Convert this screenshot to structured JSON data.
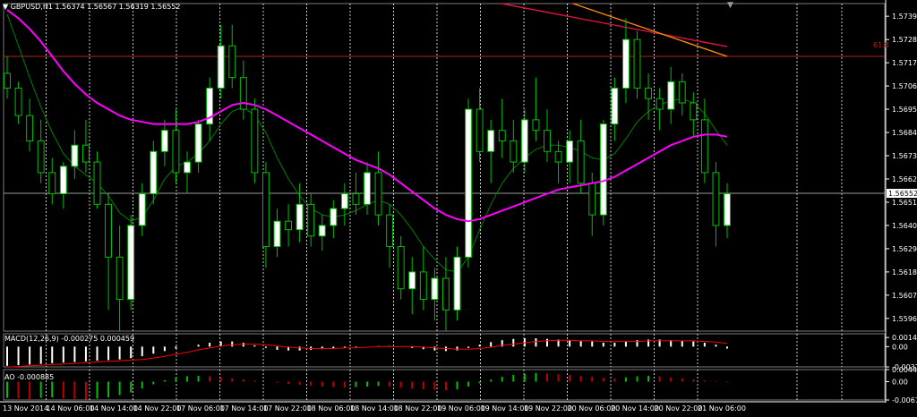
{
  "symbol_header": "GBPUSD,H1  1.56374 1.56567 1.56319 1.56552",
  "fib_label": "61.8",
  "current_price": "1.56552",
  "macd_label": "MACD(12,26,9) -0.000275 0.000459",
  "ao_label": "AO -0.000885",
  "price_ticks": [
    "1.57390",
    "1.57280",
    "1.57170",
    "1.57060",
    "1.56950",
    "1.56840",
    "1.56730",
    "1.56620",
    "1.56510",
    "1.56400",
    "1.56290",
    "1.56180",
    "1.56070",
    "1.55960"
  ],
  "macd_ticks": [
    "0.001422",
    "0.00",
    "-0.003165"
  ],
  "ao_ticks": [
    "0.004483",
    "0.00",
    "-0.006797"
  ],
  "time_labels": [
    "13 Nov 2014",
    "14 Nov 06:00",
    "14 Nov 14:00",
    "14 Nov 22:00",
    "17 Nov 06:00",
    "17 Nov 14:00",
    "17 Nov 22:00",
    "18 Nov 06:00",
    "18 Nov 14:00",
    "18 Nov 22:00",
    "19 Nov 06:00",
    "19 Nov 14:00",
    "19 Nov 22:00",
    "20 Nov 06:00",
    "20 Nov 14:00",
    "20 Nov 22:00",
    "21 Nov 06:00"
  ],
  "colors": {
    "background": "#000000",
    "candle_bull": "#ffffff",
    "candle_bear": "#000000",
    "wick": "#00c000",
    "ma_slow": "#ff00ff",
    "ma_fast": "#008000",
    "fib_line": "#b22222",
    "trend_line_1": "#ff8c00",
    "trend_line_2": "#dc143c",
    "macd_hist": "#ffffff",
    "macd_signal": "#ff0000",
    "ao_up": "#00c000",
    "ao_down": "#c00000",
    "grid": "#ffffff"
  },
  "chart_data": {
    "type": "candlestick",
    "symbol": "GBPUSD",
    "timeframe": "H1",
    "ylim": [
      1.559,
      1.5745
    ],
    "fib_level": {
      "label": "61.8",
      "price": 1.572
    },
    "current_price": 1.56552,
    "candles": [
      [
        1.5712,
        1.572,
        1.57,
        1.5705
      ],
      [
        1.5705,
        1.5708,
        1.5688,
        1.5692
      ],
      [
        1.5692,
        1.57,
        1.5675,
        1.568
      ],
      [
        1.568,
        1.569,
        1.566,
        1.5665
      ],
      [
        1.5665,
        1.5672,
        1.565,
        1.5655
      ],
      [
        1.5655,
        1.567,
        1.5648,
        1.5668
      ],
      [
        1.5668,
        1.5685,
        1.5662,
        1.5678
      ],
      [
        1.5678,
        1.569,
        1.5665,
        1.567
      ],
      [
        1.567,
        1.5675,
        1.5648,
        1.565
      ],
      [
        1.565,
        1.5655,
        1.56,
        1.5625
      ],
      [
        1.5625,
        1.564,
        1.559,
        1.5605
      ],
      [
        1.5605,
        1.5645,
        1.56,
        1.564
      ],
      [
        1.564,
        1.566,
        1.5635,
        1.5655
      ],
      [
        1.5655,
        1.568,
        1.565,
        1.5675
      ],
      [
        1.5675,
        1.569,
        1.5668,
        1.5685
      ],
      [
        1.5685,
        1.5695,
        1.566,
        1.5665
      ],
      [
        1.5665,
        1.5675,
        1.5655,
        1.567
      ],
      [
        1.567,
        1.569,
        1.5665,
        1.5688
      ],
      [
        1.5688,
        1.571,
        1.568,
        1.5705
      ],
      [
        1.5705,
        1.5735,
        1.57,
        1.5725
      ],
      [
        1.5725,
        1.5735,
        1.5705,
        1.571
      ],
      [
        1.571,
        1.5718,
        1.569,
        1.5695
      ],
      [
        1.5695,
        1.57,
        1.566,
        1.5665
      ],
      [
        1.5665,
        1.567,
        1.562,
        1.563
      ],
      [
        1.563,
        1.5648,
        1.5625,
        1.5642
      ],
      [
        1.5642,
        1.565,
        1.563,
        1.5638
      ],
      [
        1.5638,
        1.566,
        1.5632,
        1.565
      ],
      [
        1.565,
        1.5655,
        1.563,
        1.5635
      ],
      [
        1.5635,
        1.5645,
        1.5628,
        1.564
      ],
      [
        1.564,
        1.5652,
        1.5634,
        1.5648
      ],
      [
        1.5648,
        1.566,
        1.564,
        1.5655
      ],
      [
        1.5655,
        1.5665,
        1.5645,
        1.565
      ],
      [
        1.565,
        1.567,
        1.5645,
        1.5665
      ],
      [
        1.5665,
        1.5675,
        1.564,
        1.5645
      ],
      [
        1.5645,
        1.565,
        1.562,
        1.563
      ],
      [
        1.563,
        1.5635,
        1.5605,
        1.561
      ],
      [
        1.561,
        1.5625,
        1.5598,
        1.5618
      ],
      [
        1.5618,
        1.563,
        1.56,
        1.5605
      ],
      [
        1.5605,
        1.562,
        1.5595,
        1.5615
      ],
      [
        1.5615,
        1.5625,
        1.559,
        1.56
      ],
      [
        1.56,
        1.563,
        1.5595,
        1.5625
      ],
      [
        1.5625,
        1.57,
        1.562,
        1.5695
      ],
      [
        1.5695,
        1.5705,
        1.567,
        1.5675
      ],
      [
        1.5675,
        1.569,
        1.566,
        1.5685
      ],
      [
        1.5685,
        1.57,
        1.5672,
        1.568
      ],
      [
        1.568,
        1.569,
        1.5665,
        1.567
      ],
      [
        1.567,
        1.5695,
        1.5665,
        1.569
      ],
      [
        1.569,
        1.571,
        1.568,
        1.5685
      ],
      [
        1.5685,
        1.5695,
        1.567,
        1.5675
      ],
      [
        1.5675,
        1.568,
        1.566,
        1.567
      ],
      [
        1.567,
        1.5685,
        1.566,
        1.568
      ],
      [
        1.568,
        1.569,
        1.5655,
        1.566
      ],
      [
        1.566,
        1.5665,
        1.5635,
        1.5645
      ],
      [
        1.5645,
        1.569,
        1.564,
        1.5688
      ],
      [
        1.5688,
        1.571,
        1.568,
        1.5705
      ],
      [
        1.5705,
        1.5738,
        1.5698,
        1.5728
      ],
      [
        1.5728,
        1.5732,
        1.57,
        1.5705
      ],
      [
        1.5705,
        1.5712,
        1.569,
        1.57
      ],
      [
        1.57,
        1.5705,
        1.5685,
        1.5695
      ],
      [
        1.5695,
        1.5715,
        1.5688,
        1.5708
      ],
      [
        1.5708,
        1.5712,
        1.5692,
        1.5698
      ],
      [
        1.5698,
        1.5703,
        1.5682,
        1.569
      ],
      [
        1.569,
        1.57,
        1.566,
        1.5665
      ],
      [
        1.5665,
        1.567,
        1.563,
        1.564
      ],
      [
        1.564,
        1.566,
        1.5634,
        1.5655
      ]
    ],
    "ma_slow": [
      1.5742,
      1.5738,
      1.5733,
      1.5727,
      1.572,
      1.5713,
      1.5707,
      1.5702,
      1.5698,
      1.5695,
      1.5692,
      1.569,
      1.5689,
      1.5688,
      1.5688,
      1.5688,
      1.5688,
      1.5689,
      1.5691,
      1.5694,
      1.5697,
      1.5698,
      1.5697,
      1.5695,
      1.5692,
      1.5689,
      1.5686,
      1.5683,
      1.568,
      1.5677,
      1.5674,
      1.5671,
      1.5669,
      1.5667,
      1.5664,
      1.566,
      1.5656,
      1.5652,
      1.5648,
      1.5645,
      1.5643,
      1.5642,
      1.5643,
      1.5645,
      1.5647,
      1.5649,
      1.5651,
      1.5653,
      1.5655,
      1.5657,
      1.5658,
      1.5659,
      1.566,
      1.5661,
      1.5663,
      1.5666,
      1.5669,
      1.5672,
      1.5675,
      1.5678,
      1.568,
      1.5682,
      1.5683,
      1.5683,
      1.5682
    ],
    "ma_fast": [
      1.574,
      1.5725,
      1.571,
      1.5696,
      1.5684,
      1.5674,
      1.5668,
      1.5664,
      1.566,
      1.5654,
      1.5646,
      1.5642,
      1.5644,
      1.5652,
      1.5662,
      1.5668,
      1.567,
      1.5674,
      1.568,
      1.5688,
      1.5694,
      1.5696,
      1.5692,
      1.5684,
      1.5672,
      1.5662,
      1.5654,
      1.5648,
      1.5645,
      1.5644,
      1.5645,
      1.5647,
      1.565,
      1.5652,
      1.565,
      1.5645,
      1.5638,
      1.563,
      1.5624,
      1.5619,
      1.5618,
      1.5625,
      1.5638,
      1.565,
      1.566,
      1.5667,
      1.5672,
      1.5676,
      1.5678,
      1.5678,
      1.5677,
      1.5675,
      1.5672,
      1.5671,
      1.5674,
      1.5681,
      1.5689,
      1.5694,
      1.5697,
      1.5699,
      1.57,
      1.5698,
      1.5693,
      1.5685,
      1.5678
    ],
    "macd": {
      "ylim": [
        -0.003165,
        0.002
      ],
      "hist": [
        -0.003,
        -0.0029,
        -0.0028,
        -0.0027,
        -0.0026,
        -0.0025,
        -0.0024,
        -0.0023,
        -0.0022,
        -0.0021,
        -0.002,
        -0.0018,
        -0.0015,
        -0.0011,
        -0.0007,
        -0.0003,
        0.0,
        0.0003,
        0.0006,
        0.0008,
        0.0008,
        0.0006,
        0.0002,
        -0.0002,
        -0.0005,
        -0.0006,
        -0.0006,
        -0.0005,
        -0.0004,
        -0.0003,
        -0.0002,
        -0.0001,
        0.0,
        0.0001,
        0.0001,
        0.0,
        -0.0002,
        -0.0004,
        -0.0006,
        -0.0007,
        -0.0006,
        -0.0002,
        0.0003,
        0.0007,
        0.001,
        0.0012,
        0.0013,
        0.0013,
        0.0012,
        0.0011,
        0.001,
        0.0009,
        0.0008,
        0.0006,
        0.0006,
        0.0008,
        0.001,
        0.0011,
        0.0011,
        0.001,
        0.0009,
        0.0008,
        0.0006,
        0.0003,
        -0.0003
      ],
      "signal": [
        -0.0032,
        -0.0031,
        -0.003,
        -0.0029,
        -0.0028,
        -0.0027,
        -0.0026,
        -0.0025,
        -0.0024,
        -0.0023,
        -0.0022,
        -0.0021,
        -0.002,
        -0.0018,
        -0.0015,
        -0.0012,
        -0.0009,
        -0.0005,
        -0.0002,
        0.0001,
        0.0003,
        0.0004,
        0.0004,
        0.0003,
        0.0001,
        -0.0001,
        -0.0002,
        -0.0003,
        -0.0003,
        -0.0003,
        -0.0002,
        -0.0002,
        -0.0001,
        0.0,
        0.0,
        0.0,
        0.0,
        -0.0001,
        -0.0002,
        -0.0003,
        -0.0004,
        -0.0004,
        -0.0003,
        -0.0001,
        0.0002,
        0.0004,
        0.0006,
        0.0008,
        0.0009,
        0.001,
        0.001,
        0.0009,
        0.0009,
        0.0008,
        0.0008,
        0.0008,
        0.0008,
        0.0009,
        0.0009,
        0.0009,
        0.0009,
        0.0009,
        0.0008,
        0.0007,
        0.0005
      ]
    },
    "ao": {
      "ylim": [
        -0.006797,
        0.004483
      ],
      "values": [
        -0.006,
        -0.0062,
        -0.0065,
        -0.006,
        -0.0058,
        -0.0062,
        -0.0064,
        -0.0066,
        -0.0063,
        -0.0058,
        -0.005,
        -0.004,
        -0.0025,
        -0.001,
        0.0005,
        0.0015,
        0.002,
        0.0022,
        0.002,
        0.0016,
        0.0012,
        0.0008,
        0.0004,
        0.0,
        -0.0004,
        -0.0008,
        -0.0012,
        -0.0015,
        -0.0018,
        -0.002,
        -0.0022,
        -0.002,
        -0.0018,
        -0.0016,
        -0.0018,
        -0.0022,
        -0.0026,
        -0.0028,
        -0.003,
        -0.0032,
        -0.0028,
        -0.0018,
        -0.0006,
        0.0008,
        0.0018,
        0.0025,
        0.003,
        0.0032,
        0.003,
        0.0028,
        0.0025,
        0.0022,
        0.0018,
        0.0014,
        0.0012,
        0.0016,
        0.002,
        0.0022,
        0.002,
        0.0016,
        0.0012,
        0.0008,
        0.0004,
        0.0002,
        -0.0002
      ]
    }
  }
}
